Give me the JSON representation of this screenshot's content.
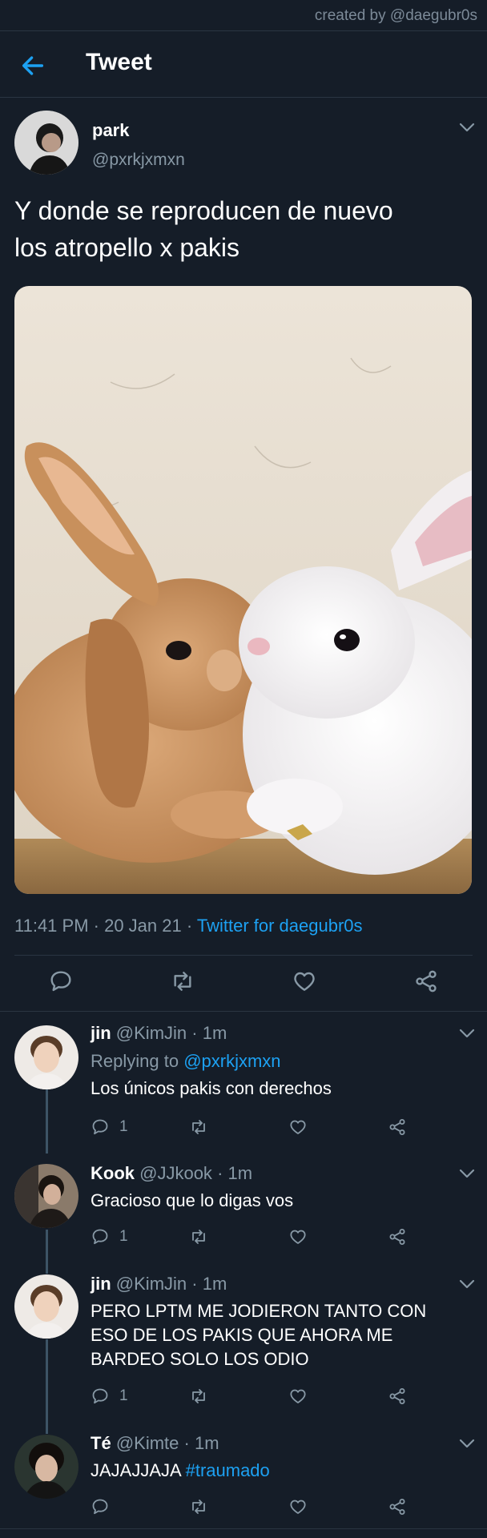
{
  "credit": "created by @daegubr0s",
  "header": {
    "title": "Tweet"
  },
  "tweet": {
    "name": "park",
    "handle": "@pxrkjxmxn",
    "text_line1": "Y donde se reproducen de nuevo",
    "text_line2": "los atropello x pakis",
    "time": "11:41 PM · 20 Jan 21 · ",
    "source": "Twitter for daegubr0s"
  },
  "replies": [
    {
      "name": "jin",
      "handle": "@KimJin",
      "time": "· 1m",
      "replying_prefix": "Replying to ",
      "replying_to": "@pxrkjxmxn",
      "lines": [
        "Los únicos pakis con derechos"
      ],
      "reply_count": "1"
    },
    {
      "name": "Kook",
      "handle": "@JJkook",
      "time": "· 1m",
      "lines": [
        "Gracioso que lo digas vos"
      ],
      "reply_count": "1"
    },
    {
      "name": "jin",
      "handle": "@KimJin",
      "time": "· 1m",
      "lines": [
        "PERO LPTM ME JODIERON TANTO CON",
        "ESO DE LOS PAKIS QUE AHORA ME",
        "BARDEO SOLO LOS ODIO"
      ],
      "reply_count": "1"
    },
    {
      "name": "Té",
      "handle": "@Kimte",
      "time": "· 1m",
      "text": "JAJAJJAJA ",
      "hashtag": "#traumado"
    }
  ],
  "colors": {
    "background": "#151d28",
    "accent": "#1da1f2",
    "secondary_text": "#8899a6",
    "divider": "#2a3542"
  },
  "icons": [
    "back-arrow-icon",
    "chevron-down-icon",
    "reply-icon",
    "retweet-icon",
    "like-icon",
    "share-icon"
  ]
}
